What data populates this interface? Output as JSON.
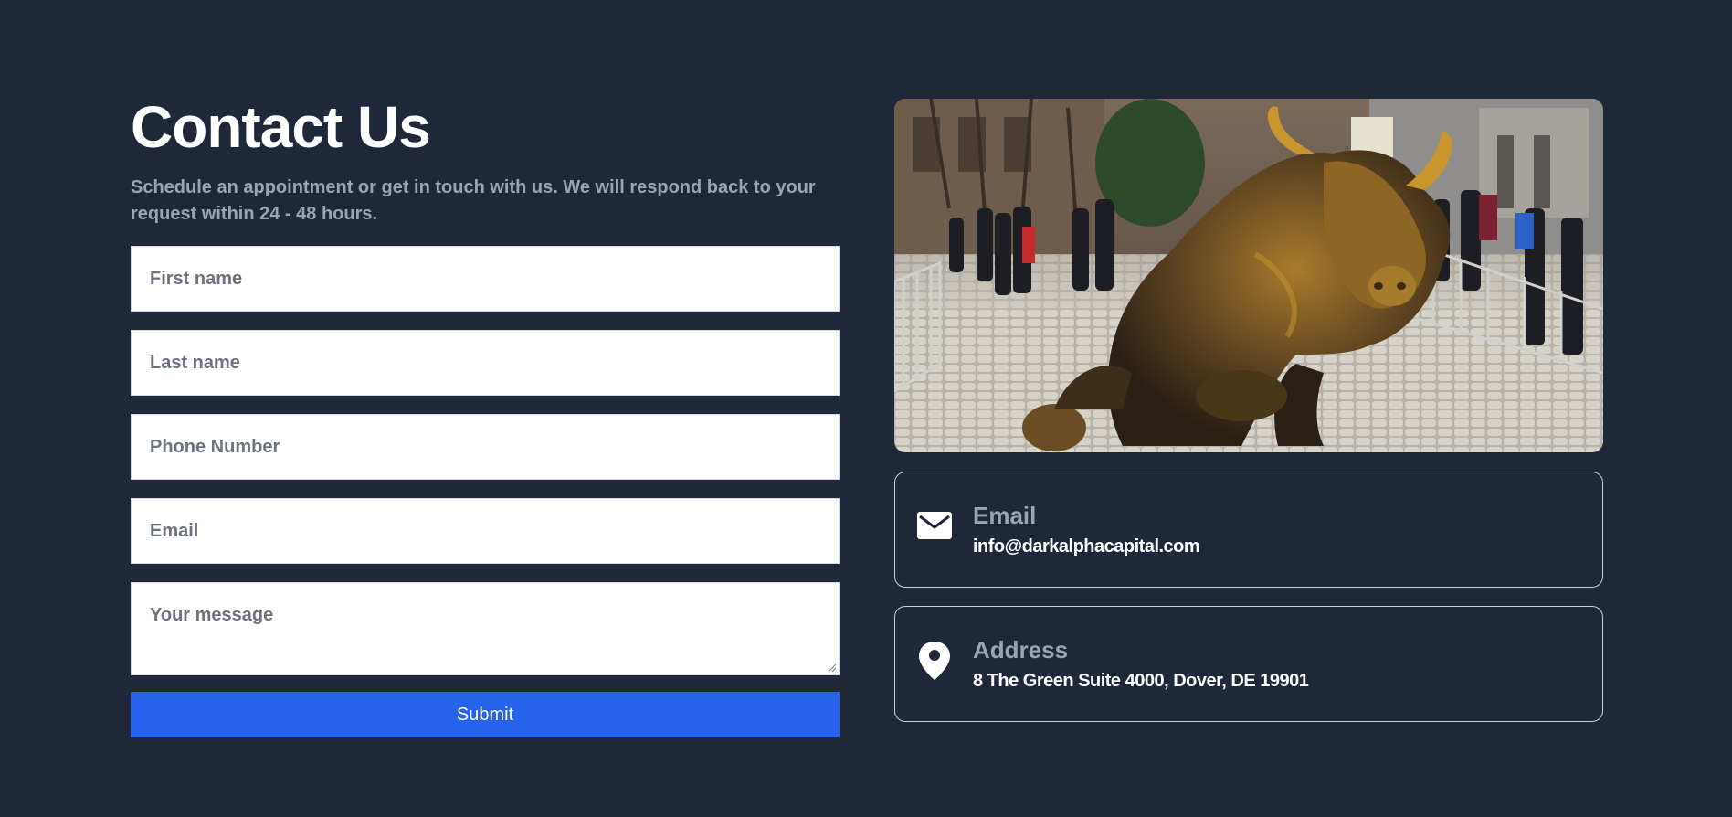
{
  "contact": {
    "title": "Contact Us",
    "subtitle": "Schedule an appointment or get in touch with us. We will respond back to your request within 24 - 48 hours.",
    "form": {
      "first_name_placeholder": "First name",
      "last_name_placeholder": "Last name",
      "phone_placeholder": "Phone Number",
      "email_placeholder": "Email",
      "message_placeholder": "Your message",
      "submit_label": "Submit"
    }
  },
  "info": {
    "email": {
      "icon": "envelope-icon",
      "label": "Email",
      "value": "info@darkalphacapital.com"
    },
    "address": {
      "icon": "map-pin-icon",
      "label": "Address",
      "value": "8 The Green Suite 4000, Dover, DE 19901"
    }
  },
  "colors": {
    "background": "#1f2839",
    "accent": "#2563eb",
    "muted_text": "#9aa4b2"
  }
}
